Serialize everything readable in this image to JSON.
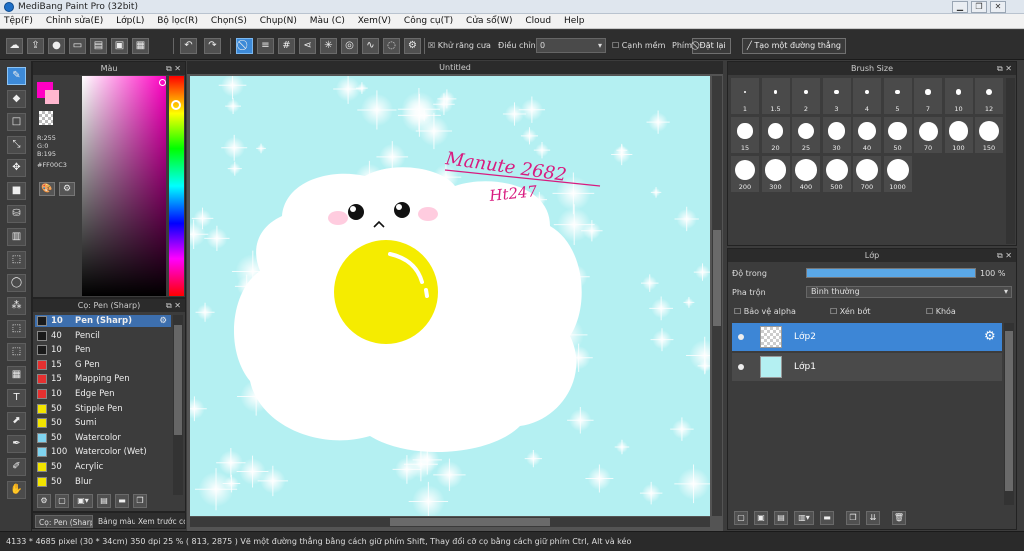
{
  "app": {
    "title": "MediBang Paint Pro (32bit)"
  },
  "menu": [
    "Tệp(F)",
    "Chỉnh sửa(E)",
    "Lớp(L)",
    "Bộ lọc(R)",
    "Chọn(S)",
    "Chụp(N)",
    "Màu (C)",
    "Xem(V)",
    "Công cụ(T)",
    "Cửa sổ(W)",
    "Cloud",
    "Help"
  ],
  "toolbar": {
    "antialias_label": "Khử răng cưa",
    "correction_label": "Điều chỉnh",
    "correction_value": "0",
    "soft_edge_label": "Cạnh mềm",
    "key_label": "Phím",
    "reset_label": "Đặt lại",
    "straight_line_label": "Tạo một đường thẳng"
  },
  "color_panel": {
    "title": "Màu",
    "r": "R:255",
    "g": "G:0",
    "b": "B:195",
    "hex": "#FF00C3",
    "primary_color": "#ff00c3",
    "secondary_color": "#ffb7cf"
  },
  "brush_panel": {
    "title": "Cọ: Pen (Sharp)",
    "items": [
      {
        "size": "10",
        "name": "Pen (Sharp)",
        "color": "#1a1a1a",
        "selected": true
      },
      {
        "size": "40",
        "name": "Pencil",
        "color": "#1a1a1a"
      },
      {
        "size": "10",
        "name": "Pen",
        "color": "#1a1a1a"
      },
      {
        "size": "15",
        "name": "G Pen",
        "color": "#e53030"
      },
      {
        "size": "15",
        "name": "Mapping Pen",
        "color": "#e53030"
      },
      {
        "size": "10",
        "name": "Edge Pen",
        "color": "#e53030"
      },
      {
        "size": "50",
        "name": "Stipple Pen",
        "color": "#f2e400"
      },
      {
        "size": "50",
        "name": "Sumi",
        "color": "#f2e400"
      },
      {
        "size": "50",
        "name": "Watercolor",
        "color": "#7fd3ef"
      },
      {
        "size": "100",
        "name": "Watercolor (Wet)",
        "color": "#7fd3ef"
      },
      {
        "size": "50",
        "name": "Acrylic",
        "color": "#f2e400"
      },
      {
        "size": "50",
        "name": "Blur",
        "color": "#f2e400"
      }
    ],
    "tabs": [
      "Cọ: Pen (Sharp)",
      "Bảng màu",
      "Xem trước cọ"
    ]
  },
  "canvas": {
    "title": "Untitled",
    "signature_line1": "Manute 2682",
    "signature_line2": "Ht247"
  },
  "brush_size_panel": {
    "title": "Brush Size",
    "sizes": [
      "1",
      "1.5",
      "2",
      "3",
      "4",
      "5",
      "7",
      "10",
      "12",
      "15",
      "20",
      "25",
      "30",
      "40",
      "50",
      "70",
      "100",
      "150",
      "200",
      "300",
      "400",
      "500",
      "700",
      "1000"
    ]
  },
  "layer_panel": {
    "title": "Lớp",
    "opacity_label": "Độ trong",
    "opacity_value": "100 %",
    "blend_label": "Pha trộn",
    "blend_value": "Bình thường",
    "protect_alpha": "Bảo vệ alpha",
    "clipping": "Xén bớt",
    "lock": "Khóa",
    "layers": [
      {
        "name": "Lớp2",
        "selected": true
      },
      {
        "name": "Lớp1",
        "selected": false
      }
    ]
  },
  "status": {
    "text": "4133 * 4685 pixel  (30 * 34cm)  350 dpi  25 %  ( 813, 2875 )  Vẽ một đường thẳng bằng cách giữ phím Shift, Thay đổi cỡ cọ bằng cách giữ phím Ctrl, Alt và kéo"
  }
}
